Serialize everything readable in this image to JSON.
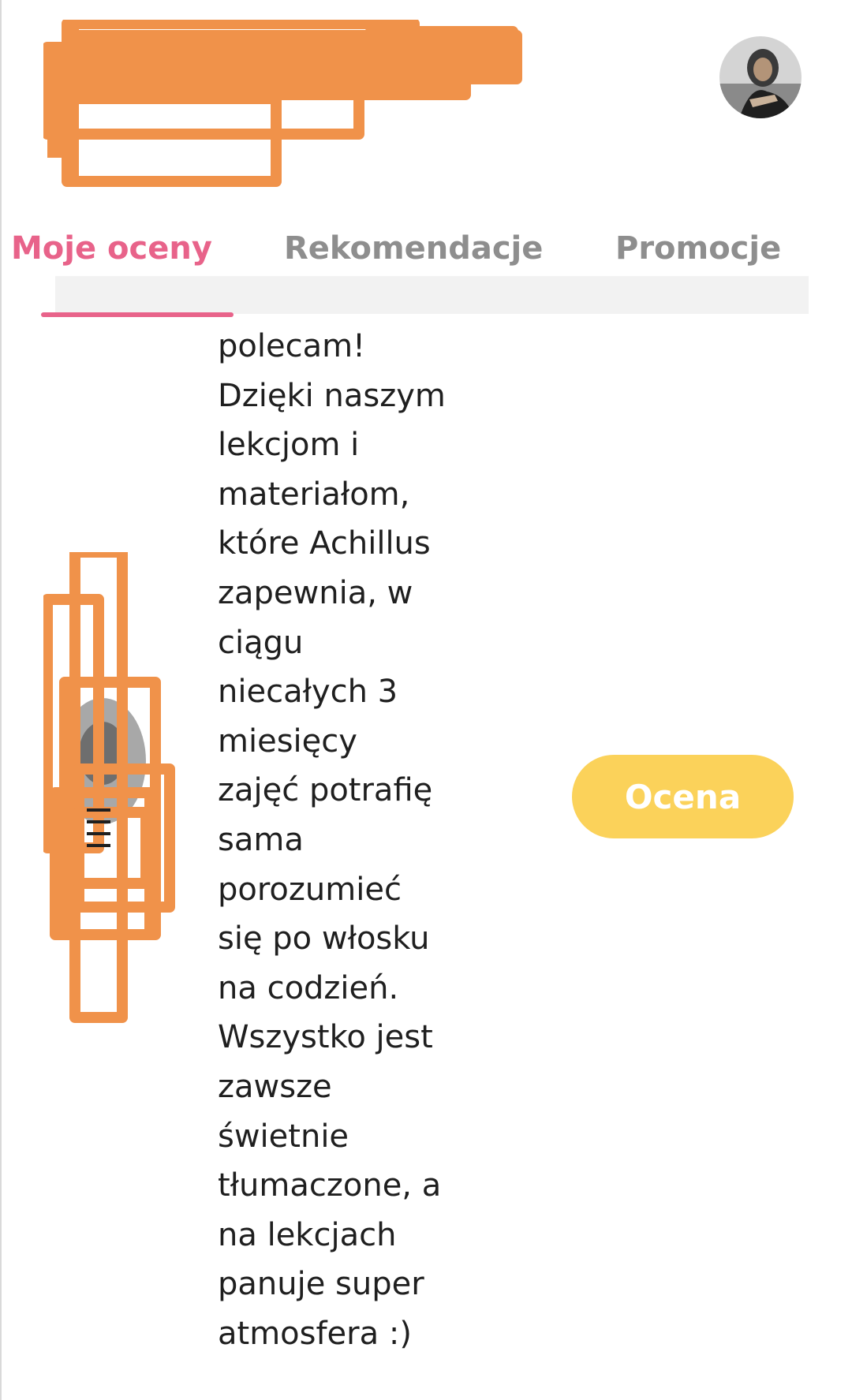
{
  "tabs": [
    {
      "label": "Moje oceny",
      "active": true
    },
    {
      "label": "Rekomendacje",
      "active": false
    },
    {
      "label": "Promocje",
      "active": false
    }
  ],
  "review": {
    "lines": [
      "polecam!",
      "Dzięki naszym",
      "lekcjom i",
      "materiałom,",
      "które Achillus",
      "zapewnia, w",
      "ciągu",
      "niecałych 3",
      "miesięcy",
      "zajęć potrafię",
      "sama",
      "porozumieć",
      "się po włosku",
      "na codzień.",
      "Wszystko jest",
      "zawsze",
      "świetnie",
      "tłumaczone, a",
      "na lekcjach",
      "panuje super",
      "atmosfera :)"
    ]
  },
  "rating_button": {
    "label": "Ocena"
  },
  "colors": {
    "accent_pink": "#e8638a",
    "inactive_tab": "#8e8e8e",
    "button_yellow": "#fbd25a",
    "redaction_orange": "#f0924a"
  },
  "icons": {
    "profile_avatar": "user-avatar-icon",
    "reviewer_avatar": "reviewer-avatar-icon"
  }
}
